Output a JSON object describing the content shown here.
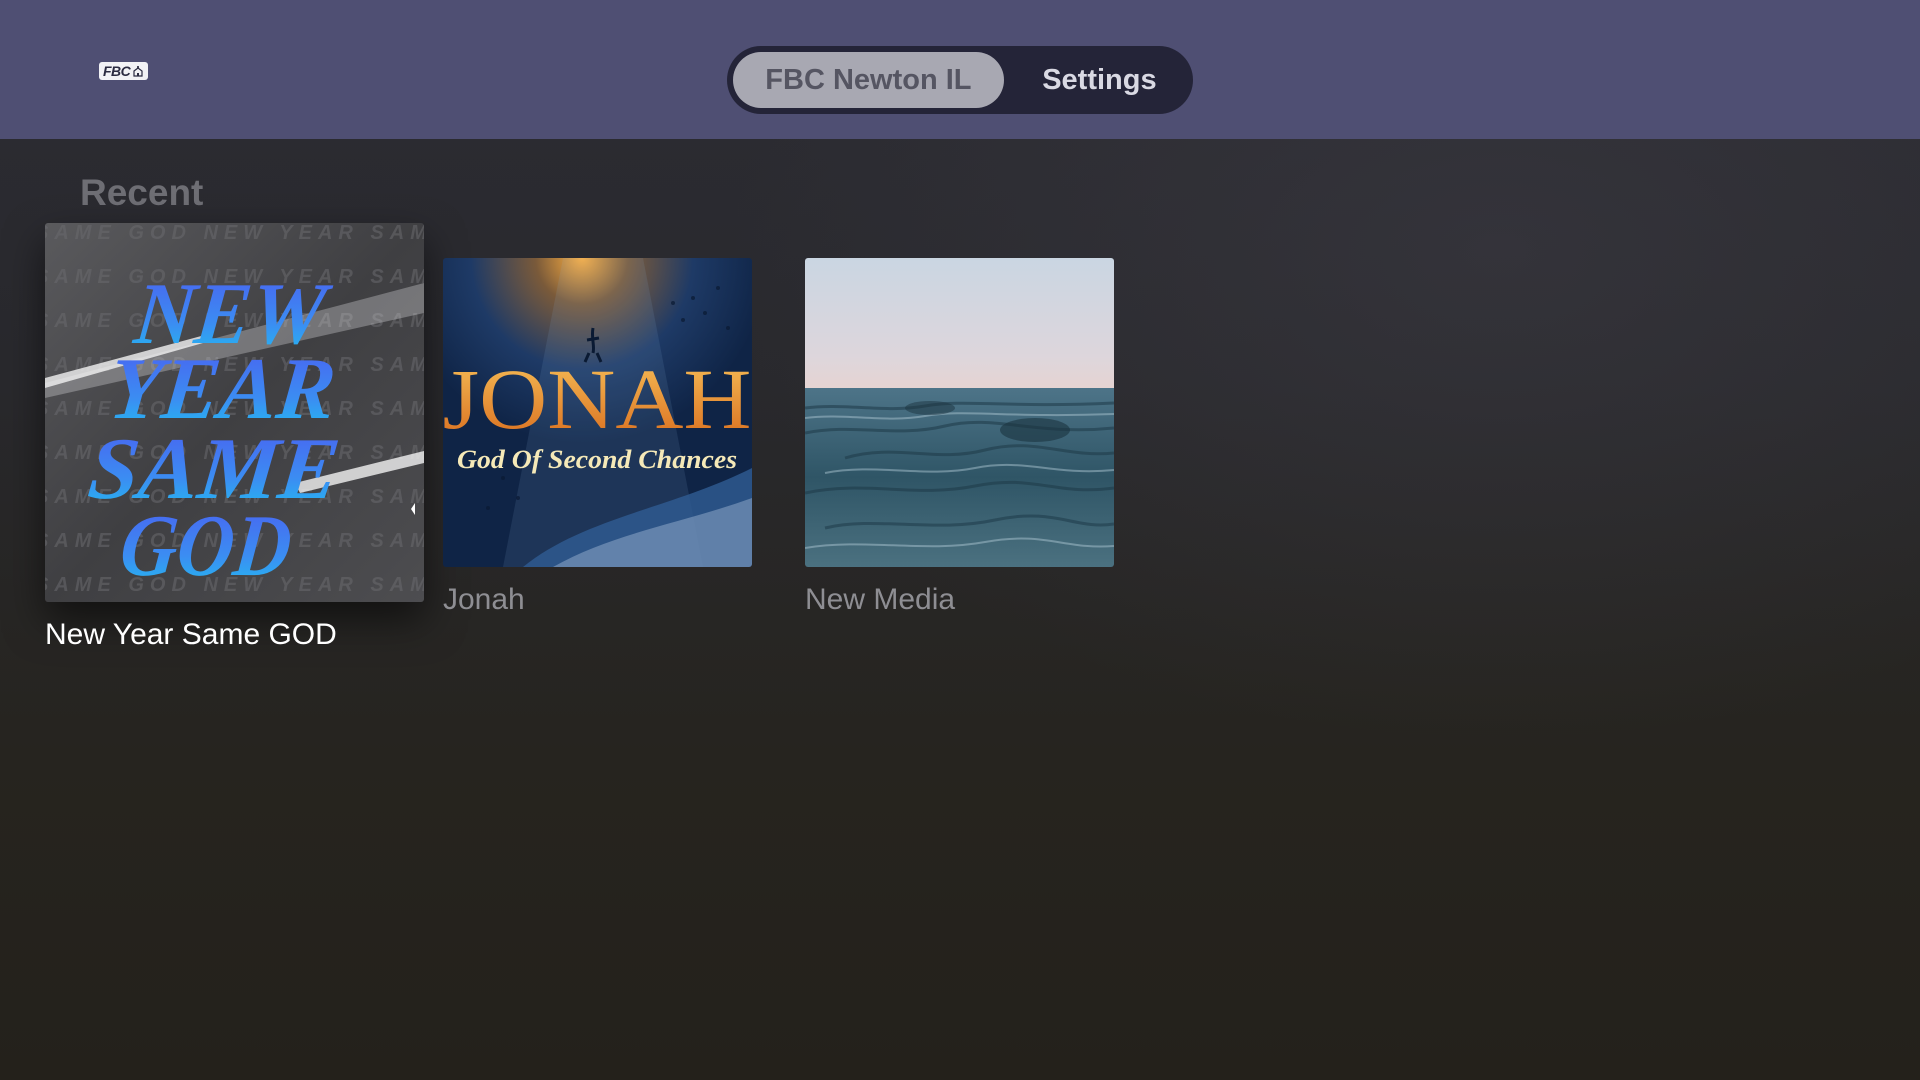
{
  "header": {
    "logo_text": "FBC",
    "tabs": [
      {
        "label": "FBC Newton IL",
        "selected": true
      },
      {
        "label": "Settings",
        "selected": false
      }
    ]
  },
  "section": {
    "title": "Recent",
    "items": [
      {
        "title": "New Year Same GOD",
        "focused": true,
        "art_lines": [
          "NEW",
          "YEAR",
          "SAME",
          "GOD"
        ],
        "pattern_text": "SAME GOD NEW YEAR SAME GOD NEW YEAR",
        "palette": {
          "bg": "#4a4a4c",
          "accent_top": "#4b6cf0",
          "accent_bottom": "#1fb9f0"
        }
      },
      {
        "title": "Jonah",
        "focused": false,
        "art_title": "JONAH",
        "art_subtitle": "God Of Second Chances",
        "palette": {
          "bg": "#1a3a66",
          "title": "#e48a2c",
          "subtitle": "#f5e9b8"
        }
      },
      {
        "title": "New Media",
        "focused": false,
        "palette": {
          "sky": "#cfd9e3",
          "horizon": "#e6d4d0",
          "water": "#3f6373"
        }
      }
    ]
  },
  "icons": [
    "fbc-logo-icon",
    "church-icon"
  ]
}
